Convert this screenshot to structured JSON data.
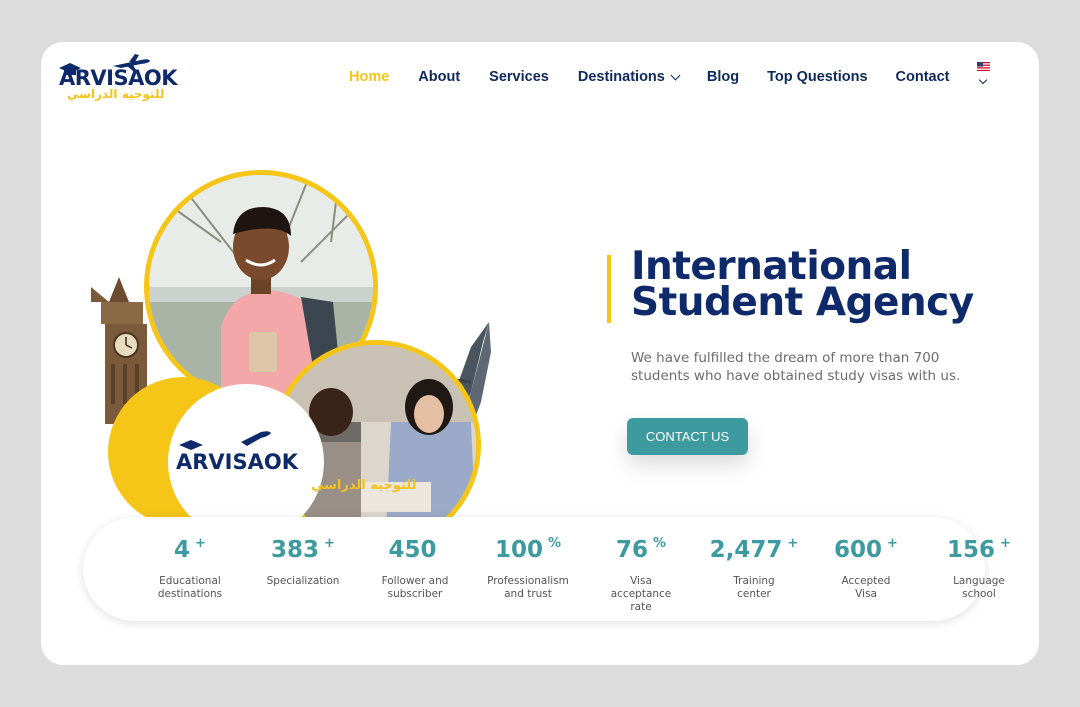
{
  "logo": {
    "brand": "ARVISAOK",
    "brand_ar": "للتوجيه الدراسي"
  },
  "nav": {
    "items": [
      {
        "label": "Home"
      },
      {
        "label": "About"
      },
      {
        "label": "Services"
      },
      {
        "label": "Destinations"
      },
      {
        "label": "Blog"
      },
      {
        "label": "Top Questions"
      },
      {
        "label": "Contact"
      }
    ],
    "language_icon": "us-flag-icon"
  },
  "hero": {
    "heading_line1": "International",
    "heading_line2": "Student Agency",
    "subtext": "We have fulfilled the dream of more than 700 students who have obtained study visas with us.",
    "cta": "CONTACT US"
  },
  "stats": [
    {
      "value": "4",
      "suffix": "+",
      "label": "Educational\ndestinations"
    },
    {
      "value": "383",
      "suffix": "+",
      "label": "Specialization"
    },
    {
      "value": "450",
      "suffix": "",
      "label": "Follower and\nsubscriber"
    },
    {
      "value": "100",
      "suffix": "%",
      "label": "Professionalism\nand trust"
    },
    {
      "value": "76",
      "suffix": "%",
      "label": "Visa\nacceptance\nrate"
    },
    {
      "value": "2,477",
      "suffix": "+",
      "label": "Training\ncenter"
    },
    {
      "value": "600",
      "suffix": "+",
      "label": "Accepted\nVisa"
    },
    {
      "value": "156",
      "suffix": "+",
      "label": "Language\nschool"
    }
  ],
  "colors": {
    "navy": "#0e2a6b",
    "yellow": "#f5c518",
    "teal": "#3d9a9f"
  }
}
